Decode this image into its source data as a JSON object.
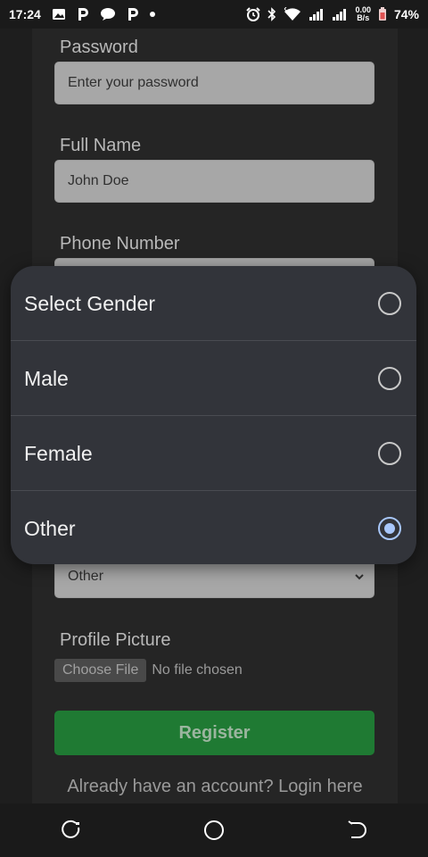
{
  "status_bar": {
    "time": "17:24",
    "net_speed_value": "0.00",
    "net_speed_unit": "B/s",
    "battery": "74%",
    "icons": [
      "image-icon",
      "p-app-icon",
      "chat-icon",
      "p-app-icon",
      "dot-icon",
      "alarm-icon",
      "bluetooth-icon",
      "wifi-icon",
      "signal-icon",
      "signal-icon",
      "battery-icon"
    ]
  },
  "form": {
    "password_label": "Password",
    "password_placeholder": "Enter your password",
    "fullname_label": "Full Name",
    "fullname_value": "John Doe",
    "phone_label": "Phone Number",
    "gender_select_value": "Other",
    "profile_picture_label": "Profile Picture",
    "choose_file_label": "Choose File",
    "file_status": "No file chosen",
    "register_label": "Register",
    "login_link": "Already have an account? Login here"
  },
  "gender_dialog": {
    "options": [
      {
        "label": "Select Gender",
        "selected": false
      },
      {
        "label": "Male",
        "selected": false
      },
      {
        "label": "Female",
        "selected": false
      },
      {
        "label": "Other",
        "selected": true
      }
    ]
  },
  "nav_bar": {
    "icons": [
      "recents-icon",
      "home-icon",
      "back-icon"
    ]
  },
  "colors": {
    "background": "#1e1e1e",
    "card": "#252525",
    "input": "#a7a7a7",
    "register_button": "#1f7a33",
    "dialog": "#32343a",
    "radio_accent": "#a8c7fa"
  }
}
